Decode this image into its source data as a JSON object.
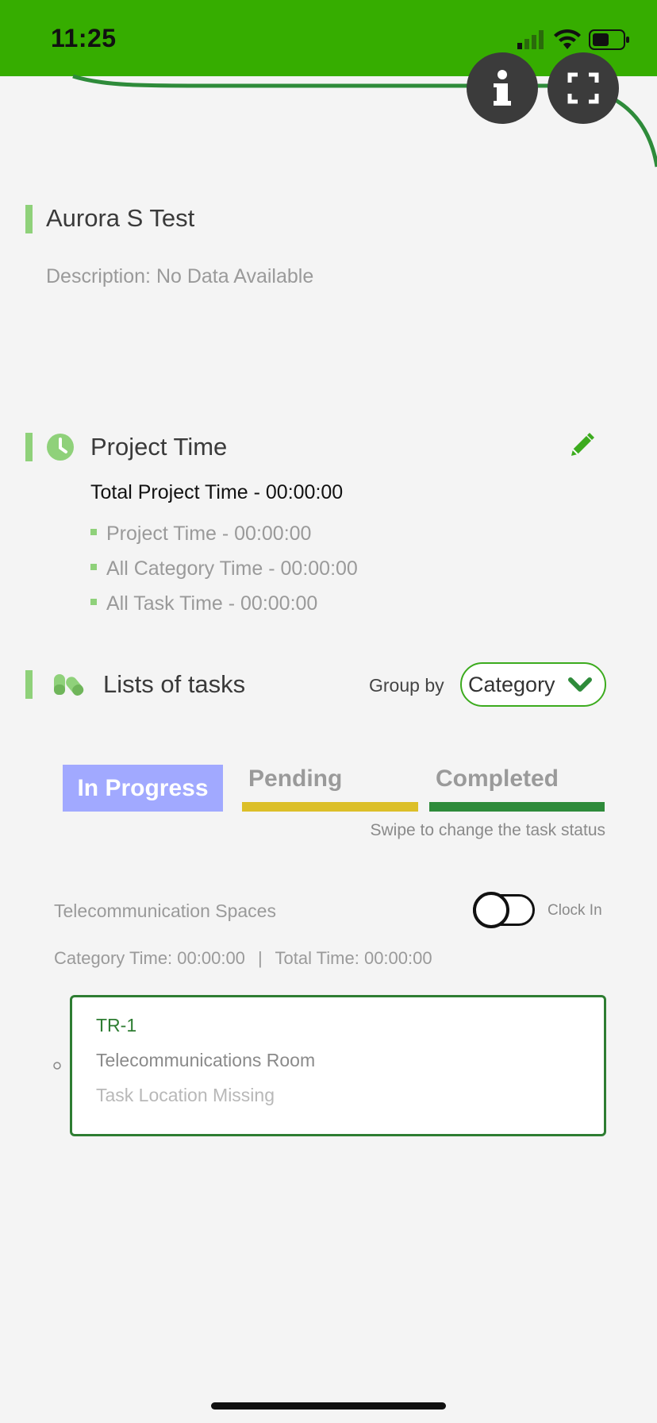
{
  "status_bar": {
    "time": "11:25"
  },
  "project": {
    "name": "Aurora S Test",
    "description": "Description: No Data Available"
  },
  "project_time": {
    "title": "Project Time",
    "total": "Total Project Time - 00:00:00",
    "items": [
      "Project Time - 00:00:00",
      "All Category Time - 00:00:00",
      "All Task Time - 00:00:00"
    ]
  },
  "tasks_section": {
    "title": "Lists of tasks",
    "group_by_label": "Group by",
    "group_by_value": "Category"
  },
  "status_tabs": {
    "tabs": [
      {
        "label": "In Progress",
        "color": "#a1a9ff"
      },
      {
        "label": "Pending",
        "color": "#dcbf28"
      },
      {
        "label": "Completed",
        "color": "#2e8b3a"
      }
    ],
    "hint": "Swipe to change the task status"
  },
  "category": {
    "name": "Telecommunication Spaces",
    "clock_label": "Clock In",
    "category_time": "Category Time: 00:00:00",
    "separator": "|",
    "total_time": "Total Time: 00:00:00"
  },
  "task": {
    "code": "TR-1",
    "name": "Telecommunications Room",
    "location": "Task Location Missing"
  },
  "colors": {
    "brand_green": "#36ad00",
    "accent_green": "#8fd17a",
    "card_border": "#2e7d32"
  }
}
